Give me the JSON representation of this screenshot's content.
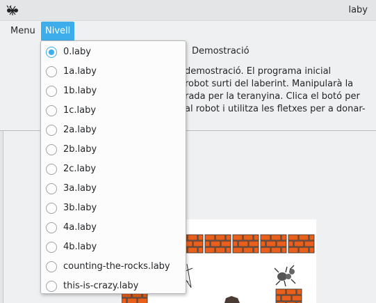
{
  "window": {
    "title": "laby"
  },
  "menubar": {
    "items": [
      {
        "label": "Menu"
      },
      {
        "label": "Nivell"
      }
    ]
  },
  "main": {
    "heading": "Demostració",
    "description": "demostració. El programa inicial\nrobot surti del laberint. Manipularà la\nrada per la teranyina. Clica el botó per\nal robot i utilitza les fletxes per a donar-"
  },
  "dropdown": {
    "options": [
      {
        "label": "0.laby",
        "selected": true
      },
      {
        "label": "1a.laby",
        "selected": false
      },
      {
        "label": "1b.laby",
        "selected": false
      },
      {
        "label": "1c.laby",
        "selected": false
      },
      {
        "label": "2a.laby",
        "selected": false
      },
      {
        "label": "2b.laby",
        "selected": false
      },
      {
        "label": "2c.laby",
        "selected": false
      },
      {
        "label": "3a.laby",
        "selected": false
      },
      {
        "label": "3b.laby",
        "selected": false
      },
      {
        "label": "4a.laby",
        "selected": false
      },
      {
        "label": "4b.laby",
        "selected": false
      },
      {
        "label": "counting-the-rocks.laby",
        "selected": false
      },
      {
        "label": "this-is-crazy.laby",
        "selected": false
      }
    ]
  },
  "icons": {
    "app": "ant-icon",
    "robot": "ant-robot-icon",
    "rock": "rock-icon",
    "web": "spider-web-icon",
    "wall": "brick-wall-icon"
  },
  "colors": {
    "accent": "#3daee9",
    "brick": "#e8601c",
    "brick_mortar": "#2b2b2b"
  }
}
